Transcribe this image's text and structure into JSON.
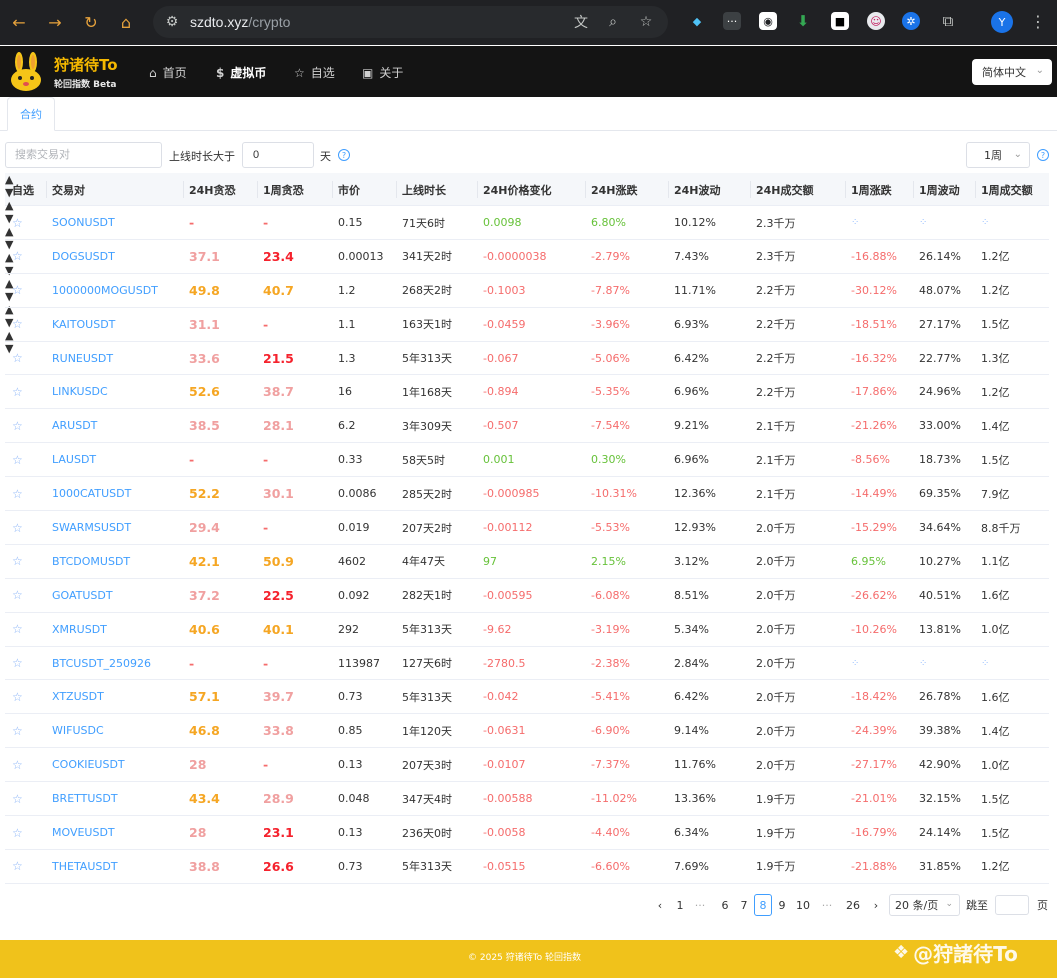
{
  "browser": {
    "url_host": "szdto.xyz",
    "url_path": "/crypto",
    "profile_initial": "Y"
  },
  "app": {
    "brand": "狩诸待To",
    "brand_sub": "轮回指数 Beta",
    "nav": [
      {
        "label": "首页"
      },
      {
        "label": "虚拟币"
      },
      {
        "label": "自选"
      },
      {
        "label": "关于"
      }
    ],
    "language": "简体中文"
  },
  "tabs": [
    {
      "label": "合约"
    }
  ],
  "filters": {
    "search_placeholder": "搜索交易对",
    "online_label": "上线时长大于",
    "online_value": "0",
    "online_unit": "天",
    "period": "1周"
  },
  "table": {
    "columns": [
      "自选",
      "交易对",
      "24H贪恐",
      "1周贪恐",
      "市价",
      "上线时长",
      "24H价格变化",
      "24H涨跌",
      "24H波动",
      "24H成交额",
      "1周涨跌",
      "1周波动",
      "1周成交额"
    ],
    "rows": [
      {
        "symbol": "SOONUSDT",
        "fg24": "-",
        "fgw": "-",
        "price": "0.15",
        "age": "71天6时",
        "chg": "0.0098",
        "pct": "6.80%",
        "vol": "10.12%",
        "amt": "2.3千万",
        "wpct": "",
        "wvol": "",
        "wamt": ""
      },
      {
        "symbol": "DOGSUSDT",
        "fg24": "37.1",
        "fgw": "23.4",
        "price": "0.00013",
        "age": "341天2时",
        "chg": "-0.0000038",
        "pct": "-2.79%",
        "vol": "7.43%",
        "amt": "2.3千万",
        "wpct": "-16.88%",
        "wvol": "26.14%",
        "wamt": "1.2亿"
      },
      {
        "symbol": "1000000MOGUSDT",
        "fg24": "49.8",
        "fgw": "40.7",
        "price": "1.2",
        "age": "268天2时",
        "chg": "-0.1003",
        "pct": "-7.87%",
        "vol": "11.71%",
        "amt": "2.2千万",
        "wpct": "-30.12%",
        "wvol": "48.07%",
        "wamt": "1.2亿"
      },
      {
        "symbol": "KAITOUSDT",
        "fg24": "31.1",
        "fgw": "-",
        "price": "1.1",
        "age": "163天1时",
        "chg": "-0.0459",
        "pct": "-3.96%",
        "vol": "6.93%",
        "amt": "2.2千万",
        "wpct": "-18.51%",
        "wvol": "27.17%",
        "wamt": "1.5亿"
      },
      {
        "symbol": "RUNEUSDT",
        "fg24": "33.6",
        "fgw": "21.5",
        "price": "1.3",
        "age": "5年313天",
        "chg": "-0.067",
        "pct": "-5.06%",
        "vol": "6.42%",
        "amt": "2.2千万",
        "wpct": "-16.32%",
        "wvol": "22.77%",
        "wamt": "1.3亿"
      },
      {
        "symbol": "LINKUSDC",
        "fg24": "52.6",
        "fgw": "38.7",
        "price": "16",
        "age": "1年168天",
        "chg": "-0.894",
        "pct": "-5.35%",
        "vol": "6.96%",
        "amt": "2.2千万",
        "wpct": "-17.86%",
        "wvol": "24.96%",
        "wamt": "1.2亿"
      },
      {
        "symbol": "ARUSDT",
        "fg24": "38.5",
        "fgw": "28.1",
        "price": "6.2",
        "age": "3年309天",
        "chg": "-0.507",
        "pct": "-7.54%",
        "vol": "9.21%",
        "amt": "2.1千万",
        "wpct": "-21.26%",
        "wvol": "33.00%",
        "wamt": "1.4亿"
      },
      {
        "symbol": "LAUSDT",
        "fg24": "-",
        "fgw": "-",
        "price": "0.33",
        "age": "58天5时",
        "chg": "0.001",
        "pct": "0.30%",
        "vol": "6.96%",
        "amt": "2.1千万",
        "wpct": "-8.56%",
        "wvol": "18.73%",
        "wamt": "1.5亿"
      },
      {
        "symbol": "1000CATUSDT",
        "fg24": "52.2",
        "fgw": "30.1",
        "price": "0.0086",
        "age": "285天2时",
        "chg": "-0.000985",
        "pct": "-10.31%",
        "vol": "12.36%",
        "amt": "2.1千万",
        "wpct": "-14.49%",
        "wvol": "69.35%",
        "wamt": "7.9亿"
      },
      {
        "symbol": "SWARMSUSDT",
        "fg24": "29.4",
        "fgw": "-",
        "price": "0.019",
        "age": "207天2时",
        "chg": "-0.00112",
        "pct": "-5.53%",
        "vol": "12.93%",
        "amt": "2.0千万",
        "wpct": "-15.29%",
        "wvol": "34.64%",
        "wamt": "8.8千万"
      },
      {
        "symbol": "BTCDOMUSDT",
        "fg24": "42.1",
        "fgw": "50.9",
        "price": "4602",
        "age": "4年47天",
        "chg": "97",
        "pct": "2.15%",
        "vol": "3.12%",
        "amt": "2.0千万",
        "wpct": "6.95%",
        "wvol": "10.27%",
        "wamt": "1.1亿"
      },
      {
        "symbol": "GOATUSDT",
        "fg24": "37.2",
        "fgw": "22.5",
        "price": "0.092",
        "age": "282天1时",
        "chg": "-0.00595",
        "pct": "-6.08%",
        "vol": "8.51%",
        "amt": "2.0千万",
        "wpct": "-26.62%",
        "wvol": "40.51%",
        "wamt": "1.6亿"
      },
      {
        "symbol": "XMRUSDT",
        "fg24": "40.6",
        "fgw": "40.1",
        "price": "292",
        "age": "5年313天",
        "chg": "-9.62",
        "pct": "-3.19%",
        "vol": "5.34%",
        "amt": "2.0千万",
        "wpct": "-10.26%",
        "wvol": "13.81%",
        "wamt": "1.0亿"
      },
      {
        "symbol": "BTCUSDT_250926",
        "fg24": "-",
        "fgw": "-",
        "price": "113987",
        "age": "127天6时",
        "chg": "-2780.5",
        "pct": "-2.38%",
        "vol": "2.84%",
        "amt": "2.0千万",
        "wpct": "",
        "wvol": "",
        "wamt": ""
      },
      {
        "symbol": "XTZUSDT",
        "fg24": "57.1",
        "fgw": "39.7",
        "price": "0.73",
        "age": "5年313天",
        "chg": "-0.042",
        "pct": "-5.41%",
        "vol": "6.42%",
        "amt": "2.0千万",
        "wpct": "-18.42%",
        "wvol": "26.78%",
        "wamt": "1.6亿"
      },
      {
        "symbol": "WIFUSDC",
        "fg24": "46.8",
        "fgw": "33.8",
        "price": "0.85",
        "age": "1年120天",
        "chg": "-0.0631",
        "pct": "-6.90%",
        "vol": "9.14%",
        "amt": "2.0千万",
        "wpct": "-24.39%",
        "wvol": "39.38%",
        "wamt": "1.4亿"
      },
      {
        "symbol": "COOKIEUSDT",
        "fg24": "28",
        "fgw": "-",
        "price": "0.13",
        "age": "207天3时",
        "chg": "-0.0107",
        "pct": "-7.37%",
        "vol": "11.76%",
        "amt": "2.0千万",
        "wpct": "-27.17%",
        "wvol": "42.90%",
        "wamt": "1.0亿"
      },
      {
        "symbol": "BRETTUSDT",
        "fg24": "43.4",
        "fgw": "28.9",
        "price": "0.048",
        "age": "347天4时",
        "chg": "-0.00588",
        "pct": "-11.02%",
        "vol": "13.36%",
        "amt": "1.9千万",
        "wpct": "-21.01%",
        "wvol": "32.15%",
        "wamt": "1.5亿"
      },
      {
        "symbol": "MOVEUSDT",
        "fg24": "28",
        "fgw": "23.1",
        "price": "0.13",
        "age": "236天0时",
        "chg": "-0.0058",
        "pct": "-4.40%",
        "vol": "6.34%",
        "amt": "1.9千万",
        "wpct": "-16.79%",
        "wvol": "24.14%",
        "wamt": "1.5亿"
      },
      {
        "symbol": "THETAUSDT",
        "fg24": "38.8",
        "fgw": "26.6",
        "price": "0.73",
        "age": "5年313天",
        "chg": "-0.0515",
        "pct": "-6.60%",
        "vol": "7.69%",
        "amt": "1.9千万",
        "wpct": "-21.88%",
        "wvol": "31.85%",
        "wamt": "1.2亿"
      }
    ]
  },
  "pagination": {
    "pages": [
      "1",
      "6",
      "7",
      "8",
      "9",
      "10",
      "26"
    ],
    "current": "8",
    "ellipsis": "···",
    "page_size": "20 条/页",
    "jump_label": "跳至",
    "jump_unit": "页"
  },
  "footer": {
    "copyright": "© 2025 狩诸待To 轮回指数",
    "watermark": "@狩諸待To"
  },
  "colors": {
    "accent": "#409eff",
    "up": "#67c23a",
    "down": "#f56c6c",
    "brand": "#f5b800",
    "fear": "#f5222d",
    "neutral": "#f0a0a0",
    "greed": "#f5a623"
  }
}
